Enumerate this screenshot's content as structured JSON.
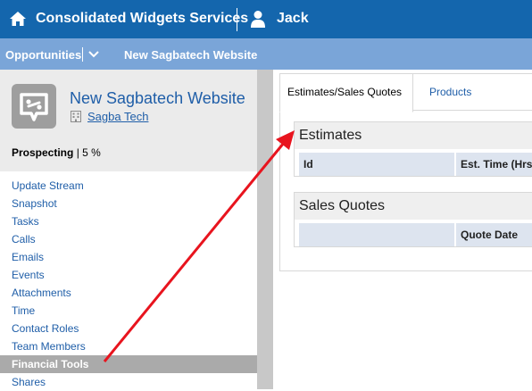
{
  "header": {
    "company": "Consolidated Widgets Services",
    "user": "Jack"
  },
  "subnav": {
    "entity": "Opportunities",
    "record": "New Sagbatech Website"
  },
  "record": {
    "title": "New Sagbatech Website",
    "company": "Sagba Tech",
    "stage": "Prospecting",
    "probability": "5 %"
  },
  "nav": {
    "items": [
      {
        "label": "Update Stream"
      },
      {
        "label": "Snapshot"
      },
      {
        "label": "Tasks"
      },
      {
        "label": "Calls"
      },
      {
        "label": "Emails"
      },
      {
        "label": "Events"
      },
      {
        "label": "Attachments"
      },
      {
        "label": "Time"
      },
      {
        "label": "Contact Roles"
      },
      {
        "label": "Team Members"
      },
      {
        "label": "Financial Tools",
        "active": true
      },
      {
        "label": "Shares"
      }
    ]
  },
  "tabs": [
    {
      "label": "Estimates/Sales Quotes",
      "active": true
    },
    {
      "label": "Products"
    }
  ],
  "estimates": {
    "title": "Estimates",
    "columns": [
      "Id",
      "Est. Time (Hrs"
    ]
  },
  "sales_quotes": {
    "title": "Sales Quotes",
    "columns": [
      "",
      "Quote Date"
    ]
  },
  "colors": {
    "header_bg": "#1466ad",
    "subnav_bg": "#7aa5d8",
    "link": "#1f5ea8",
    "annotation_arrow": "#e8141e"
  }
}
